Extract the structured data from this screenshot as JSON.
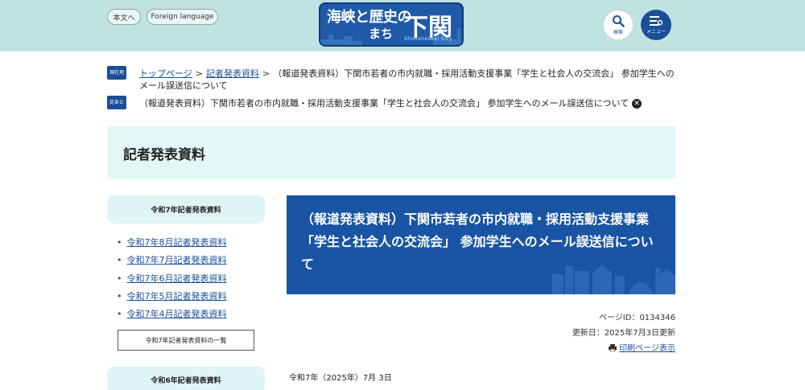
{
  "header": {
    "skip_label": "本文へ",
    "lang_label": "Foreign language",
    "logo": {
      "main": "海峡と歴史の",
      "sub": "まち",
      "city": "下関",
      "roman": "Shimonoseki City"
    },
    "search_label": "検索",
    "menu_label": "メニュー",
    "colors": {
      "band": "#bfe3e1",
      "accent": "#1a4f96"
    }
  },
  "breadcrumb": {
    "current_badge": "現在地",
    "home": "トップページ",
    "section": "記者発表資料",
    "page": "（報道発表資料）下関市若者の市内就職・採用活動支援事業「学生と社会人の交流会」 参加学生へのメール誤送信について",
    "trail_badge": "足あと",
    "trail_page": "（報道発表資料）下関市若者の市内就職・採用活動支援事業「学生と社会人の交流会」 参加学生へのメール誤送信について"
  },
  "title": "記者発表資料",
  "sidebar": {
    "heading_r7": "令和7年記者発表資料",
    "items": [
      {
        "label": "令和7年8月記者発表資料"
      },
      {
        "label": "令和7年7月記者発表資料"
      },
      {
        "label": "令和7年6月記者発表資料"
      },
      {
        "label": "令和7年5月記者発表資料"
      },
      {
        "label": "令和7年4月記者発表資料"
      }
    ],
    "all_label": "令和7年記者発表資料の一覧",
    "heading_r6": "令和6年記者発表資料"
  },
  "article": {
    "headline": "（報道発表資料）下関市若者の市内就職・採用活動支援事業「学生と社会人の交流会」 参加学生へのメール誤送信について",
    "page_id": "ページID：0134346",
    "updated": "更新日：2025年7月3日更新",
    "print_label": "印刷ページ表示",
    "date": "令和7年（2025年）7月 3日"
  }
}
